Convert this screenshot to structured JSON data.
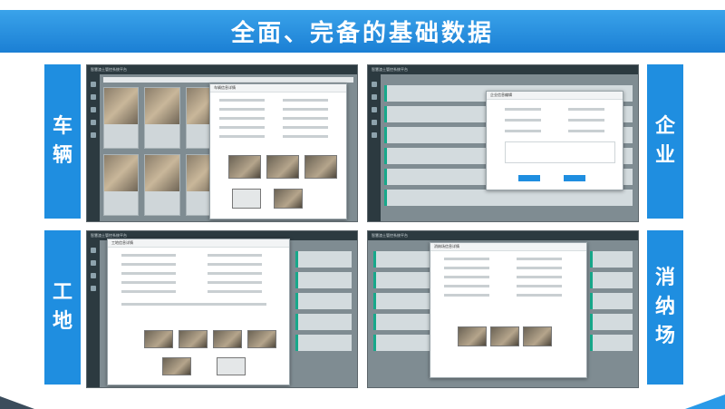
{
  "banner": {
    "title": "全面、完备的基础数据"
  },
  "sections": {
    "vehicle": {
      "label": "车\n辆"
    },
    "enterprise": {
      "label": "企\n业"
    },
    "site": {
      "label": "工\n地"
    },
    "disposal": {
      "label": "消\n纳\n场"
    }
  },
  "screens": {
    "app_title": "智慧渣土管控系统平台",
    "vehicle_dialog_title": "车辆信息详情",
    "enterprise_dialog_title": "企业信息编辑",
    "site_dialog_title": "工地信息详情",
    "disposal_dialog_title": "消纳场信息详情"
  },
  "colors": {
    "accent": "#1f8ee0",
    "banner": "#1b7fd4",
    "row_accent": "#17a88a"
  }
}
